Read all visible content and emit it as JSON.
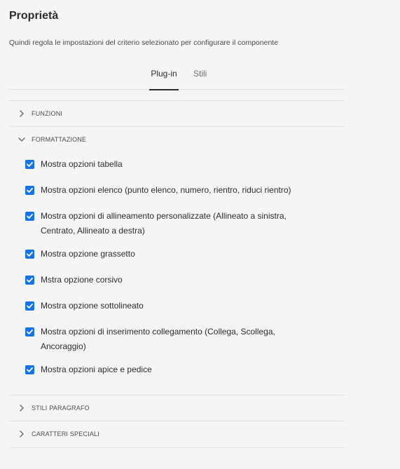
{
  "header": {
    "title": "Proprietà",
    "subtitle": "Quindi regola le impostazioni del criterio selezionato per configurare il componente"
  },
  "tabs": [
    {
      "label": "Plug-in",
      "active": true
    },
    {
      "label": "Stili",
      "active": false
    }
  ],
  "accordion": {
    "funzioni": {
      "label": "FUNZIONI",
      "expanded": false
    },
    "formattazione": {
      "label": "FORMATTAZIONE",
      "expanded": true,
      "options": [
        {
          "label": "Mostra opzioni tabella",
          "checked": true
        },
        {
          "label": "Mostra opzioni elenco (punto elenco, numero, rientro, riduci rientro)",
          "checked": true
        },
        {
          "label": "Mostra opzioni di allineamento personalizzate (Allineato a sinistra, Centrato, Allineato a destra)",
          "checked": true
        },
        {
          "label": "Mostra opzione grassetto",
          "checked": true
        },
        {
          "label": "Mstra opzione corsivo",
          "checked": true
        },
        {
          "label": "Mostra opzione sottolineato",
          "checked": true
        },
        {
          "label": "Mostra opzioni di inserimento collegamento (Collega, Scollega, Ancoraggio)",
          "checked": true
        },
        {
          "label": "Mostra opzioni apice e pedice",
          "checked": true
        }
      ]
    },
    "stili_paragrafo": {
      "label": "STILI PARAGRAFO",
      "expanded": false
    },
    "caratteri_speciali": {
      "label": "CARATTERI SPECIALI",
      "expanded": false
    }
  },
  "colors": {
    "checkbox": "#1473e6",
    "background": "#f5f5f5",
    "divider": "#e1e1e1"
  },
  "icons": {
    "collapsed": "chevron-right-icon",
    "expanded": "chevron-down-icon",
    "checkbox": "checkmark-icon"
  }
}
